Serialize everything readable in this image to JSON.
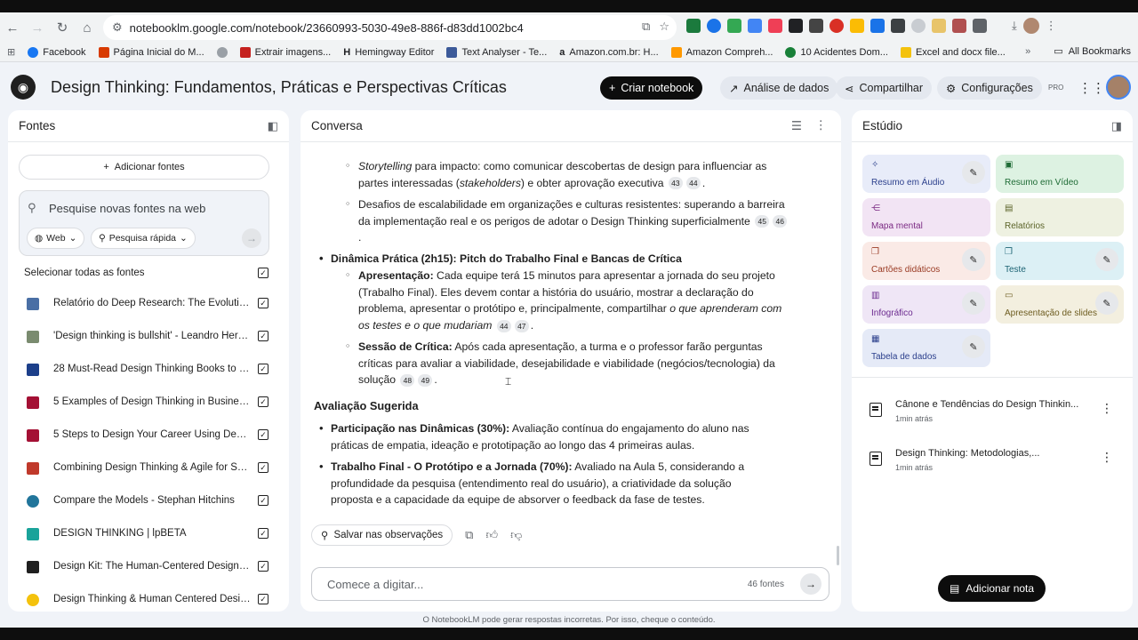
{
  "browser": {
    "url": "notebooklm.google.com/notebook/23660993-5030-49e8-886f-d83dd1002bc4",
    "bookmarks": [
      "Facebook",
      "Página Inicial do M...",
      "Extrair imagens...",
      "Hemingway Editor",
      "Text Analyser - Te...",
      "Amazon.com.br: H...",
      "Amazon Compreh...",
      "10 Acidentes Dom...",
      "Excel and docx file..."
    ],
    "all_bookmarks": "All Bookmarks"
  },
  "header": {
    "title": "Design Thinking: Fundamentos, Práticas e Perspectivas Críticas",
    "create_notebook": "Criar notebook",
    "analytics": "Análise de dados",
    "share": "Compartilhar",
    "settings": "Configurações",
    "pro_badge": "PRO"
  },
  "sources": {
    "title": "Fontes",
    "add_label": "Adicionar fontes",
    "search_placeholder": "Pesquise novas fontes na web",
    "chip_web": "Web",
    "chip_research": "Pesquisa rápida",
    "select_all": "Selecionar todas as fontes",
    "items": [
      {
        "title": "Relatório do Deep Research: The Evolutiona...",
        "color": "#4a6fa5"
      },
      {
        "title": "'Design thinking is bullshit' - Leandro Herrer...",
        "color": "#7a8b6f"
      },
      {
        "title": "28 Must-Read Design Thinking Books to Ins...",
        "color": "#1c3f8a"
      },
      {
        "title": "5 Examples of Design Thinking in Business |...",
        "color": "#a41034"
      },
      {
        "title": "5 Steps to Design Your Career Using Design...",
        "color": "#a41034"
      },
      {
        "title": "Combining Design Thinking & Agile for Soft...",
        "color": "#c0392b"
      },
      {
        "title": "Compare the Models - Stephan Hitchins",
        "color": "#21759b"
      },
      {
        "title": "DESIGN THINKING | lpBETA",
        "color": "#1aa39a"
      },
      {
        "title": "Design Kit: The Human-Centered Design To...",
        "color": "#1f1f1f"
      },
      {
        "title": "Design Thinking & Human Centered Design ...",
        "color": "#f4c20d"
      }
    ]
  },
  "chat": {
    "title": "Conversa",
    "p1_em": "Storytelling",
    "p1_a": " para impacto: como comunicar descobertas de design para influenciar as partes interessadas (",
    "p1_em2": "stakeholders",
    "p1_b": ") e obter aprovação executiva",
    "p1_c1": "43",
    "p1_c2": "44",
    "p2": "Desafios de escalabilidade em organizações e culturas resistentes: superando a barreira da implementação real e os perigos de adotar o Design Thinking superficialmente",
    "p2_c1": "45",
    "p2_c2": "46",
    "h1": "Dinâmica Prática (2h15): Pitch do Trabalho Final e Bancas de Crítica",
    "p3_b": "Apresentação:",
    "p3": " Cada equipe terá 15 minutos para apresentar a jornada do seu projeto (Trabalho Final). Eles devem contar a história do usuário, mostrar a declaração do problema, apresentar o protótipo e, principalmente, compartilhar ",
    "p3_em": "o que aprenderam com os testes e o que mudariam",
    "p3_c1": "44",
    "p3_c2": "47",
    "p4_b": "Sessão de Crítica:",
    "p4": " Após cada apresentação, a turma e o professor farão perguntas críticas para avaliar a viabilidade, desejabilidade e viabilidade (negócios/tecnologia) da solução",
    "p4_c1": "48",
    "p4_c2": "49",
    "h2": "Avaliação Sugerida",
    "p5_b": "Participação nas Dinâmicas (30%):",
    "p5": " Avaliação contínua do engajamento do aluno nas práticas de empatia, ideação e prototipação ao longo das 4 primeiras aulas.",
    "p6_b": "Trabalho Final - O Protótipo e a Jornada (70%):",
    "p6": " Avaliado na Aula 5, considerando a profundidade da pesquisa (entendimento real do usuário), a criatividade da solução proposta e a capacidade da equipe de absorver o feedback da fase de testes.",
    "save_notes": "Salvar nas observações",
    "input_placeholder": "Comece a digitar...",
    "source_count": "46 fontes"
  },
  "studio": {
    "title": "Estúdio",
    "cards": [
      {
        "label": "Resumo em Áudio",
        "bg": "#e8ecf9",
        "fg": "#2b3f8c"
      },
      {
        "label": "Resumo em Vídeo",
        "bg": "#ddf2e2",
        "fg": "#1e6b35"
      },
      {
        "label": "Mapa mental",
        "bg": "#f2e4f4",
        "fg": "#7b2a83"
      },
      {
        "label": "Relatórios",
        "bg": "#eef1e1",
        "fg": "#5b6328"
      },
      {
        "label": "Cartões didáticos",
        "bg": "#faeae6",
        "fg": "#9a3b24"
      },
      {
        "label": "Teste",
        "bg": "#dcf0f5",
        "fg": "#1c6373"
      },
      {
        "label": "Infográfico",
        "bg": "#efe6f6",
        "fg": "#6b2a8f"
      },
      {
        "label": "Apresentação de slides",
        "bg": "#f3efdf",
        "fg": "#6e5d21"
      },
      {
        "label": "Tabela de dados",
        "bg": "#e5eaf7",
        "fg": "#2b3f8c"
      }
    ],
    "notes": [
      {
        "title": "Cânone e Tendências do Design Thinkin...",
        "time": "1min atrás"
      },
      {
        "title": "Design Thinking: Metodologias,...",
        "time": "1min atrás"
      }
    ],
    "add_note": "Adicionar nota"
  },
  "footer": "O NotebookLM pode gerar respostas incorretas. Por isso, cheque o conteúdo."
}
